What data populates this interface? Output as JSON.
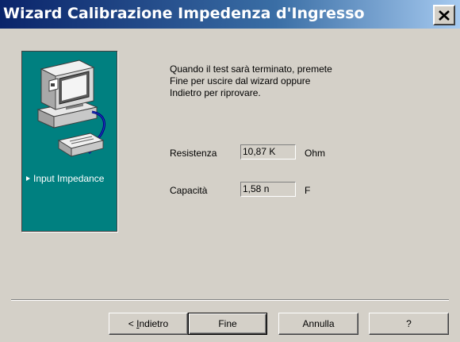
{
  "window": {
    "title": "Wizard Calibrazione Impedenza d'Ingresso",
    "close_icon": "close-icon"
  },
  "side_panel": {
    "illustration": "computer-with-device-icon",
    "step_label": "Input Impedance",
    "background": "#008080"
  },
  "message": {
    "lines": [
      "Quando il test sarà terminato, premete",
      "Fine per uscire dal wizard oppure",
      "Indietro per riprovare."
    ]
  },
  "fields": {
    "resistance": {
      "label": "Resistenza",
      "value": "10,87 K",
      "unit": "Ohm"
    },
    "capacitance": {
      "label": "Capacità",
      "value": "1,58 n",
      "unit": "F"
    }
  },
  "buttons": {
    "back": {
      "prefix": "< ",
      "mnemonic": "I",
      "rest": "ndietro"
    },
    "finish": "Fine",
    "cancel": "Annulla",
    "help": "?"
  }
}
